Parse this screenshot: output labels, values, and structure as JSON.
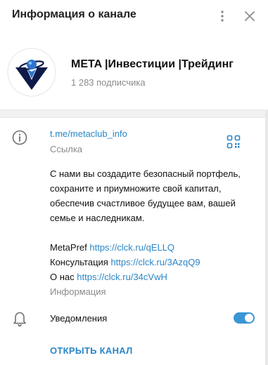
{
  "header": {
    "title": "Информация о канале",
    "more_icon": "more-vertical-icon",
    "close_icon": "close-icon"
  },
  "profile": {
    "name": "META |Инвестиции |Трейдинг",
    "subscribers": "1 283 подписчика",
    "avatar_icon": "meta-logo-icon"
  },
  "info": {
    "link": "t.me/metaclub_info",
    "link_caption": "Ссылка",
    "description_lines": [
      "С нами вы создадите безопасный портфель,",
      "сохраните и приумножите свой капитал,",
      "обеспечив счастливое будущее вам, вашей",
      "семье и наследникам."
    ],
    "links": [
      {
        "label": "MetaPref",
        "url": "https://clck.ru/qELLQ"
      },
      {
        "label": "Консультация",
        "url": "https://clck.ru/3AzqQ9"
      },
      {
        "label": "О нас",
        "url": "https://clck.ru/34cVwH"
      }
    ],
    "caption": "Информация"
  },
  "notifications": {
    "label": "Уведомления",
    "enabled": true
  },
  "actions": {
    "open_channel": "ОТКРЫТЬ КАНАЛ"
  },
  "colors": {
    "accent": "#2a86c6",
    "toggle": "#3a96d6",
    "logo_dark": "#0e1a47",
    "logo_blue": "#2f74d0"
  }
}
